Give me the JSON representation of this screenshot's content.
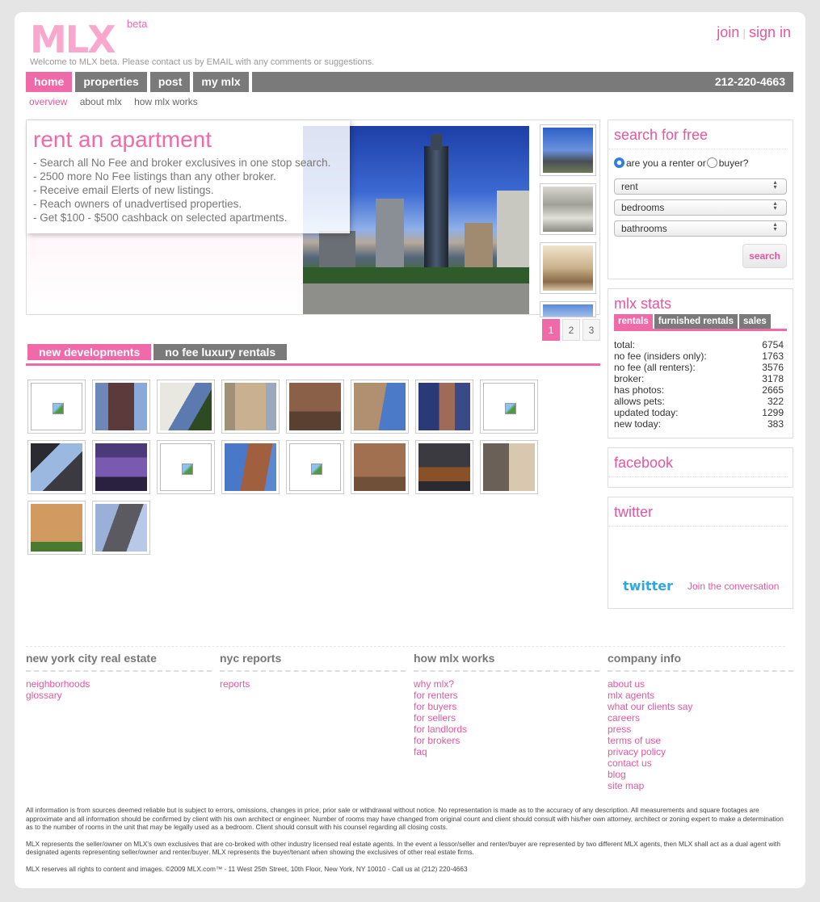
{
  "header": {
    "logo_text": "MLX",
    "logo_badge": "beta",
    "welcome": "Welcome to MLX beta. Please contact us by EMAIL with any comments or suggestions.",
    "join": "join",
    "signin": "sign in"
  },
  "nav": {
    "tabs": [
      "home",
      "properties",
      "post",
      "my mlx"
    ],
    "phone": "212-220-4663",
    "sub": [
      "overview",
      "about mlx",
      "how mlx works"
    ]
  },
  "hero": {
    "title": "rent an apartment",
    "bullets": [
      "- Search all No Fee and broker exclusives in one stop search.",
      "- 2500 more No Fee listings than any other broker.",
      "- Receive email Elerts of new listings.",
      "- Reach owners of unadvertised properties.",
      "- Get $100 - $500 cashback on selected apartments."
    ],
    "pages": [
      "1",
      "2",
      "3"
    ]
  },
  "listings": {
    "tabs": [
      "new developments",
      "no fee luxury rentals"
    ]
  },
  "search": {
    "title": "search for free",
    "question_a": "are you a renter or",
    "question_b": "buyer?",
    "select_rent": "rent",
    "select_bedrooms": "bedrooms",
    "select_bathrooms": "bathrooms",
    "button": "search"
  },
  "stats": {
    "title": "mlx stats",
    "tabs": [
      "rentals",
      "furnished rentals",
      "sales"
    ],
    "rows": [
      {
        "label": "total:",
        "value": "6754"
      },
      {
        "label": "no fee (insiders only):",
        "value": "1763"
      },
      {
        "label": "no fee (all renters):",
        "value": "3576"
      },
      {
        "label": "broker:",
        "value": "3178"
      },
      {
        "label": "has photos:",
        "value": "2665"
      },
      {
        "label": "allows pets:",
        "value": "322"
      },
      {
        "label": "updated today:",
        "value": "1299"
      },
      {
        "label": "new today:",
        "value": "383"
      }
    ]
  },
  "facebook": {
    "title": "facebook"
  },
  "twitter": {
    "title": "twitter",
    "logo": "twitter",
    "link": "Join the conversation"
  },
  "footer": {
    "col1": {
      "title": "new york city real estate",
      "links": [
        "neighborhoods",
        "glossary"
      ]
    },
    "col2": {
      "title": "nyc reports",
      "links": [
        "reports"
      ]
    },
    "col3": {
      "title": "how mlx works",
      "links": [
        "why mlx?",
        "for renters",
        "for buyers",
        "for sellers",
        "for landlords",
        "for brokers",
        "faq"
      ]
    },
    "col4": {
      "title": "company info",
      "links": [
        "about us",
        "mlx agents",
        "what our clients say",
        "careers",
        "press",
        "terms of use",
        "privacy policy",
        "contact us",
        "blog",
        "site map"
      ]
    },
    "legal1": "All information is from sources deemed reliable but is subject to errors, omissions, changes in price, prior sale or withdrawal without notice. No representation is made as to the accuracy of any description. All measurements and square footages are approximate and all information should be confirmed by client with his own architect or engineer. Number of rooms may have changed from original count and client should consult with his/her own attorney, architect or zoning expert to make a determination as to the number of rooms in the unit that may be legally used as a bedroom. Client should consult with his counsel regarding all closing costs.",
    "legal2": "MLX represents the seller/owner on MLX's own exclusives that are co-broked with other industry licensed real estate agents. In the event a lessor/seller and renter/buyer are represented by two different MLX agents, then MLX shall act as a dual agent with designated agents representing seller/owner and renter/buyer. MLX represents the buyer/tenant when showing the exclusives of other real estate firms.",
    "legal3": "MLX reserves all rights to content and images. ©2009 MLX.com™ - 11 West 25th Street, 10th Floor, New York, NY 10010 - Call us at (212) 220-4663"
  },
  "colors": {
    "accent": "#f06aa9",
    "nav_gray": "#7a7a7a",
    "link": "#e6559e"
  }
}
